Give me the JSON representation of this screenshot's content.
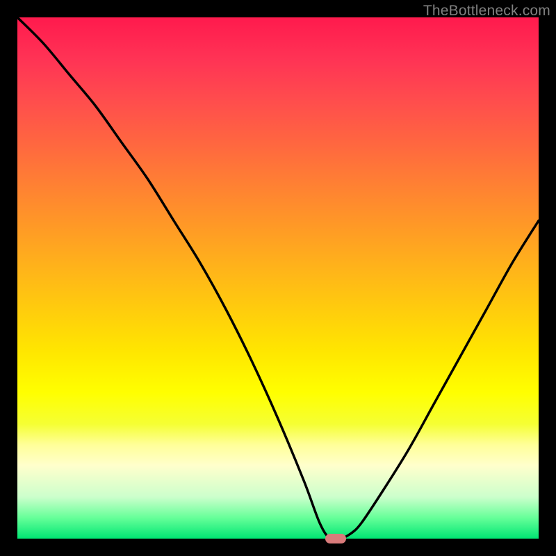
{
  "watermark": "TheBottleneck.com",
  "chart_data": {
    "type": "line",
    "title": "",
    "xlabel": "",
    "ylabel": "",
    "xlim": [
      0,
      100
    ],
    "ylim": [
      0,
      100
    ],
    "grid": false,
    "background_gradient": {
      "top": "#ff1a4d",
      "mid": "#ffe600",
      "bottom": "#00e673"
    },
    "series": [
      {
        "name": "bottleneck-curve",
        "color": "#000000",
        "x": [
          0,
          5,
          10,
          15,
          20,
          25,
          30,
          35,
          40,
          45,
          50,
          55,
          58,
          60,
          62,
          64,
          66,
          70,
          75,
          80,
          85,
          90,
          95,
          100
        ],
        "y": [
          100,
          95,
          89,
          83,
          76,
          69,
          61,
          53,
          44,
          34,
          23,
          11,
          3,
          0,
          0,
          1,
          3,
          9,
          17,
          26,
          35,
          44,
          53,
          61
        ]
      }
    ],
    "marker": {
      "x": 61,
      "y": 0,
      "color": "#d97b7b"
    }
  }
}
